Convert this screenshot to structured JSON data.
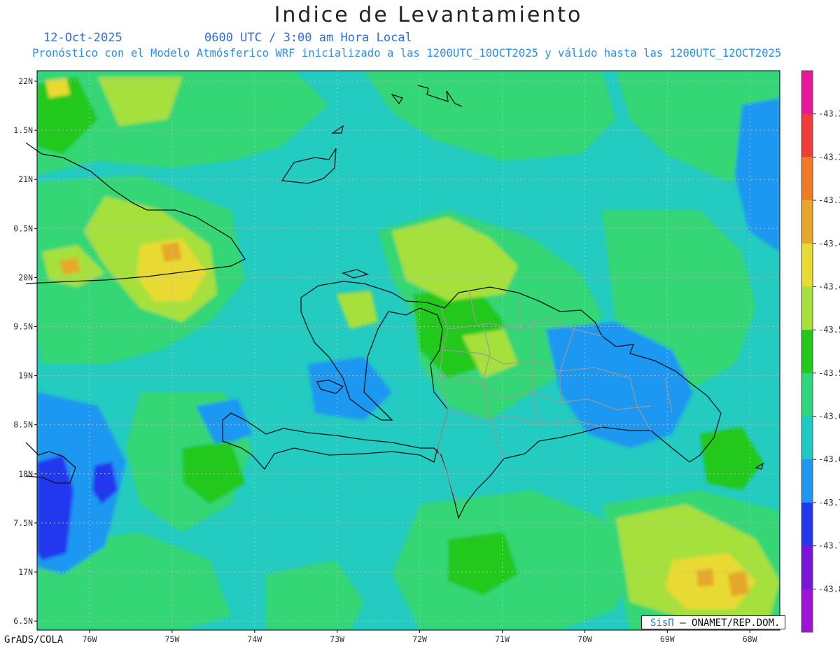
{
  "title": "Indice de Levantamiento",
  "date": "12-Oct-2025",
  "time_info": "0600 UTC / 3:00 am Hora Local",
  "forecast_info": "Pronóstico con el Modelo Atmósferico WRF inicializado a las 1200UTC_10OCT2025 y válido hasta las  1200UTC_12OCT2025",
  "credit": "GrADS/COLA",
  "logo_text": "SisΠ",
  "logo_suffix": "– ONAMET/REP.DOM.",
  "lat_labels": [
    "22N",
    "1.5N",
    "21N",
    "0.5N",
    "20N",
    "9.5N",
    "19N",
    "8.5N",
    "18N",
    "7.5N",
    "17N",
    "6.5N"
  ],
  "lon_labels": [
    "76W",
    "75W",
    "74W",
    "73W",
    "72W",
    "71W",
    "70W",
    "69W",
    "68W"
  ],
  "colorbar": {
    "labels": [
      "-43.2",
      "-43.3",
      "-43.3",
      "-43.4",
      "-43.4",
      "-43.5",
      "-43.5",
      "-43.6",
      "-43.6",
      "-43.7",
      "-43.7",
      "-43.8"
    ],
    "colors": [
      "#e8169a",
      "#f23c3c",
      "#f37a25",
      "#e6a72c",
      "#e8da30",
      "#a7e03c",
      "#22c81c",
      "#2fd679",
      "#1ec9c6",
      "#1f95f4",
      "#2237ee",
      "#7a14d8",
      "#a012d6"
    ]
  },
  "map_colors": {
    "base": "#23cbc1",
    "green": "#35d675",
    "bright_green": "#22c81c",
    "light_blue": "#1f97f2",
    "yellow_green": "#a6e03c",
    "yellow": "#e8da30",
    "orange": "#e6a72c",
    "blue": "#2237ee"
  }
}
